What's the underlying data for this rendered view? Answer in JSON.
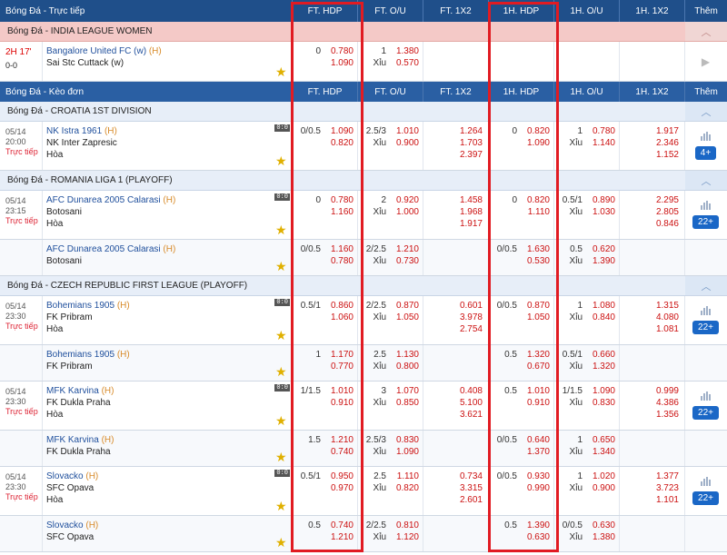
{
  "header": {
    "title": "Bóng Đá - Trực tiếp",
    "cols": [
      "FT. HDP",
      "FT. O/U",
      "FT. 1X2",
      "1H. HDP",
      "1H. O/U",
      "1H. 1X2",
      "Thêm"
    ]
  },
  "header2": {
    "title": "Bóng Đá - Kèo đơn",
    "cols": [
      "FT. HDP",
      "FT. O/U",
      "FT. 1X2",
      "1H. HDP",
      "1H. O/U",
      "1H. 1X2",
      "Thêm"
    ]
  },
  "live_league": {
    "name": "Bóng Đá - INDIA LEAGUE WOMEN",
    "match": {
      "time": "2H 17'",
      "score": "0-0",
      "home": "Bangalore United FC (w)",
      "home_tag": "(H)",
      "away": "Sai Stc Cuttack (w)",
      "hdp_line": "0",
      "hdp_home": "0.780",
      "hdp_away": "1.090",
      "ou_line": "1",
      "ou_over": "1.380",
      "ou_label": "Xỉu",
      "ou_under": "0.570"
    }
  },
  "leagues": [
    {
      "name": "Bóng Đá - CROATIA 1ST DIVISION",
      "matches": [
        {
          "date": "05/14",
          "time": "20:00",
          "status": "Trực tiếp",
          "home": "NK Istra 1961",
          "tag": "(H)",
          "away": "NK Inter Zapresic",
          "draw": "Hòa",
          "hdp_line": "0/0.5",
          "hdp_h": "1.090",
          "hdp_a": "0.820",
          "ou_line": "2.5/3",
          "ou_o": "1.010",
          "ou_u": "0.900",
          "x1": "1.264",
          "x2": "1.703",
          "xd": "2.397",
          "h1_line": "0",
          "h1_h": "0.820",
          "h1_a": "1.090",
          "h1ou_line": "1",
          "h1ou_o": "0.780",
          "h1ou_u": "1.140",
          "h1x1": "1.917",
          "h1x2": "2.346",
          "h1xd": "1.152",
          "more": "4+"
        }
      ]
    },
    {
      "name": "Bóng Đá - ROMANIA LIGA 1 (PLAYOFF)",
      "matches": [
        {
          "date": "05/14",
          "time": "23:15",
          "status": "Trực tiếp",
          "home": "AFC Dunarea 2005 Calarasi",
          "tag": "(H)",
          "away": "Botosani",
          "draw": "Hòa",
          "hdp_line": "0",
          "hdp_h": "0.780",
          "hdp_a": "1.160",
          "ou_line": "2",
          "ou_o": "0.920",
          "ou_u": "1.000",
          "x1": "1.458",
          "x2": "1.968",
          "xd": "1.917",
          "h1_line": "0",
          "h1_h": "0.820",
          "h1_a": "1.110",
          "h1ou_line": "0.5/1",
          "h1ou_o": "0.890",
          "h1ou_u": "1.030",
          "h1x1": "2.295",
          "h1x2": "2.805",
          "h1xd": "0.846",
          "more": "22+"
        },
        {
          "date": "",
          "time": "",
          "status": "",
          "home": "AFC Dunarea 2005 Calarasi",
          "tag": "(H)",
          "away": "Botosani",
          "draw": "",
          "hdp_line": "0/0.5",
          "hdp_h": "1.160",
          "hdp_a": "0.780",
          "ou_line": "2/2.5",
          "ou_o": "1.210",
          "ou_u": "0.730",
          "x1": "",
          "x2": "",
          "xd": "",
          "h1_line": "0/0.5",
          "h1_h": "1.630",
          "h1_a": "0.530",
          "h1ou_line": "0.5",
          "h1ou_o": "0.620",
          "h1ou_u": "1.390",
          "h1x1": "",
          "h1x2": "",
          "h1xd": "",
          "more": ""
        }
      ]
    },
    {
      "name": "Bóng Đá - CZECH REPUBLIC FIRST LEAGUE (PLAYOFF)",
      "matches": [
        {
          "date": "05/14",
          "time": "23:30",
          "status": "Trực tiếp",
          "home": "Bohemians 1905",
          "tag": "(H)",
          "away": "FK Pribram",
          "draw": "Hòa",
          "hdp_line": "0.5/1",
          "hdp_h": "0.860",
          "hdp_a": "1.060",
          "ou_line": "2/2.5",
          "ou_o": "0.870",
          "ou_u": "1.050",
          "x1": "0.601",
          "x2": "3.978",
          "xd": "2.754",
          "h1_line": "0/0.5",
          "h1_h": "0.870",
          "h1_a": "1.050",
          "h1ou_line": "1",
          "h1ou_o": "1.080",
          "h1ou_u": "0.840",
          "h1x1": "1.315",
          "h1x2": "4.080",
          "h1xd": "1.081",
          "more": "22+"
        },
        {
          "date": "",
          "time": "",
          "status": "",
          "home": "Bohemians 1905",
          "tag": "(H)",
          "away": "FK Pribram",
          "draw": "",
          "hdp_line": "1",
          "hdp_h": "1.170",
          "hdp_a": "0.770",
          "ou_line": "2.5",
          "ou_o": "1.130",
          "ou_u": "0.800",
          "x1": "",
          "x2": "",
          "xd": "",
          "h1_line": "0.5",
          "h1_h": "1.320",
          "h1_a": "0.670",
          "h1ou_line": "0.5/1",
          "h1ou_o": "0.660",
          "h1ou_u": "1.320",
          "h1x1": "",
          "h1x2": "",
          "h1xd": "",
          "more": ""
        },
        {
          "date": "05/14",
          "time": "23:30",
          "status": "Trực tiếp",
          "home": "MFK Karvina",
          "tag": "(H)",
          "away": "FK Dukla Praha",
          "draw": "Hòa",
          "hdp_line": "1/1.5",
          "hdp_h": "1.010",
          "hdp_a": "0.910",
          "ou_line": "3",
          "ou_o": "1.070",
          "ou_u": "0.850",
          "x1": "0.408",
          "x2": "5.100",
          "xd": "3.621",
          "h1_line": "0.5",
          "h1_h": "1.010",
          "h1_a": "0.910",
          "h1ou_line": "1/1.5",
          "h1ou_o": "1.090",
          "h1ou_u": "0.830",
          "h1x1": "0.999",
          "h1x2": "4.386",
          "h1xd": "1.356",
          "more": "22+"
        },
        {
          "date": "",
          "time": "",
          "status": "",
          "home": "MFK Karvina",
          "tag": "(H)",
          "away": "FK Dukla Praha",
          "draw": "",
          "hdp_line": "1.5",
          "hdp_h": "1.210",
          "hdp_a": "0.740",
          "ou_line": "2.5/3",
          "ou_o": "0.830",
          "ou_u": "1.090",
          "x1": "",
          "x2": "",
          "xd": "",
          "h1_line": "0/0.5",
          "h1_h": "0.640",
          "h1_a": "1.370",
          "h1ou_line": "1",
          "h1ou_o": "0.650",
          "h1ou_u": "1.340",
          "h1x1": "",
          "h1x2": "",
          "h1xd": "",
          "more": ""
        },
        {
          "date": "05/14",
          "time": "23:30",
          "status": "Trực tiếp",
          "home": "Slovacko",
          "tag": "(H)",
          "away": "SFC Opava",
          "draw": "Hòa",
          "hdp_line": "0.5/1",
          "hdp_h": "0.950",
          "hdp_a": "0.970",
          "ou_line": "2.5",
          "ou_o": "1.110",
          "ou_u": "0.820",
          "x1": "0.734",
          "x2": "3.315",
          "xd": "2.601",
          "h1_line": "0/0.5",
          "h1_h": "0.930",
          "h1_a": "0.990",
          "h1ou_line": "1",
          "h1ou_o": "1.020",
          "h1ou_u": "0.900",
          "h1x1": "1.377",
          "h1x2": "3.723",
          "h1xd": "1.101",
          "more": "22+"
        },
        {
          "date": "",
          "time": "",
          "status": "",
          "home": "Slovacko",
          "tag": "(H)",
          "away": "SFC Opava",
          "draw": "",
          "hdp_line": "0.5",
          "hdp_h": "0.740",
          "hdp_a": "1.210",
          "ou_line": "2/2.5",
          "ou_o": "0.810",
          "ou_u": "1.120",
          "x1": "",
          "x2": "",
          "xd": "",
          "h1_line": "0.5",
          "h1_h": "1.390",
          "h1_a": "0.630",
          "h1ou_line": "0/0.5",
          "h1ou_o": "0.630",
          "h1ou_u": "1.380",
          "h1x1": "",
          "h1x2": "",
          "h1xd": "",
          "more": ""
        }
      ]
    }
  ],
  "labels": {
    "under": "Xỉu",
    "collapse": "︿",
    "play": "▶"
  }
}
